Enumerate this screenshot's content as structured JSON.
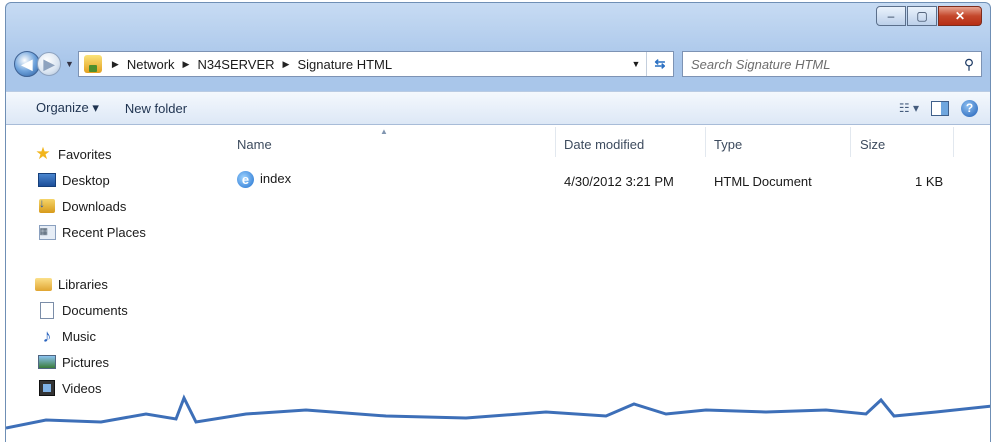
{
  "window": {
    "controls": {
      "minimize": "–",
      "maximize": "▢",
      "close": "✕"
    }
  },
  "nav": {
    "back_icon": "back-arrow-icon",
    "forward_icon": "forward-arrow-icon",
    "breadcrumbs": [
      "Network",
      "N34SERVER",
      "Signature HTML"
    ],
    "search_placeholder": "Search Signature HTML"
  },
  "toolbar": {
    "organize_label": "Organize ▾",
    "new_folder_label": "New folder",
    "help_label": "?"
  },
  "sidebar": {
    "favorites": {
      "label": "Favorites",
      "items": [
        {
          "label": "Desktop",
          "icon": "desktop-icon"
        },
        {
          "label": "Downloads",
          "icon": "downloads-icon"
        },
        {
          "label": "Recent Places",
          "icon": "recent-places-icon"
        }
      ]
    },
    "libraries": {
      "label": "Libraries",
      "items": [
        {
          "label": "Documents",
          "icon": "documents-icon"
        },
        {
          "label": "Music",
          "icon": "music-icon"
        },
        {
          "label": "Pictures",
          "icon": "pictures-icon"
        },
        {
          "label": "Videos",
          "icon": "videos-icon"
        }
      ]
    }
  },
  "file_list": {
    "columns": [
      "Name",
      "Date modified",
      "Type",
      "Size"
    ],
    "rows": [
      {
        "name": "index",
        "date_modified": "4/30/2012 3:21 PM",
        "type": "HTML Document",
        "size": "1 KB",
        "icon": "internet-explorer-icon"
      }
    ]
  },
  "colors": {
    "chrome": "#a9c6ea",
    "accent": "#1f5eb6",
    "close": "#c4472b"
  }
}
